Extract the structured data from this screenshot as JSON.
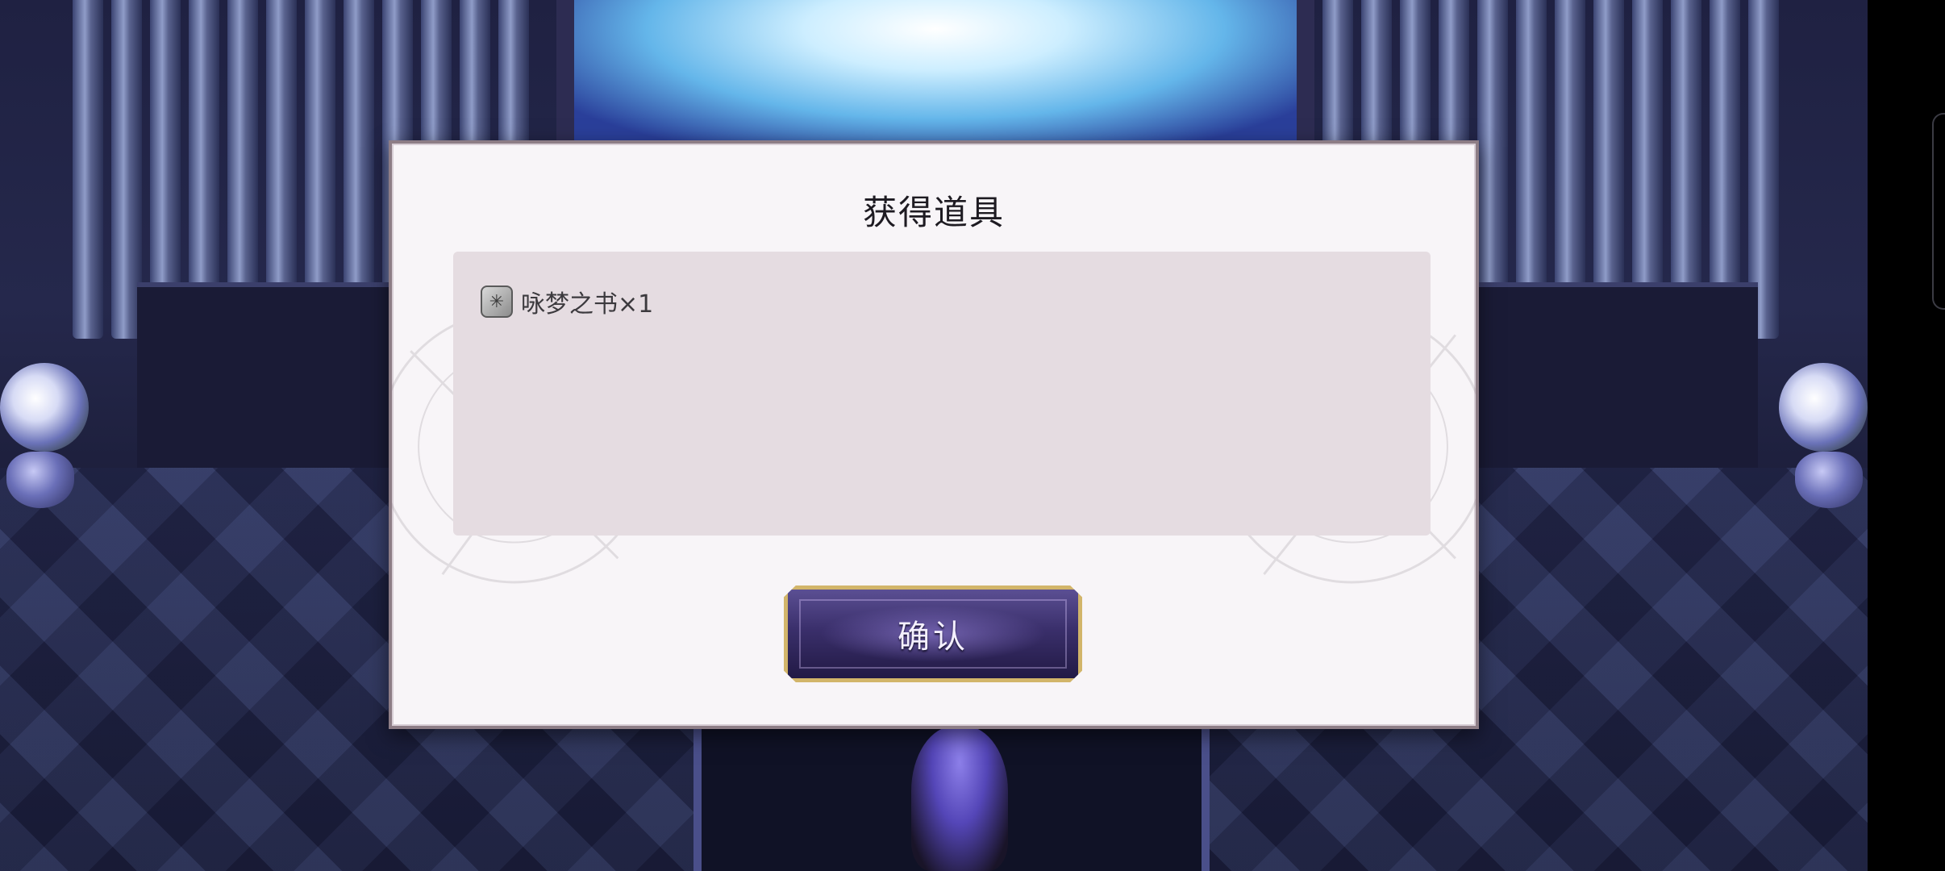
{
  "dialog": {
    "title": "获得道具",
    "items": [
      {
        "name": "咏梦之书×1",
        "icon": "book-icon"
      }
    ],
    "confirm_label": "确认"
  },
  "colors": {
    "dialog_bg": "#f8f5f8",
    "panel_bg": "#e5dce1",
    "button_bg": "#3a2f6b",
    "button_border": "#d2b56a"
  }
}
